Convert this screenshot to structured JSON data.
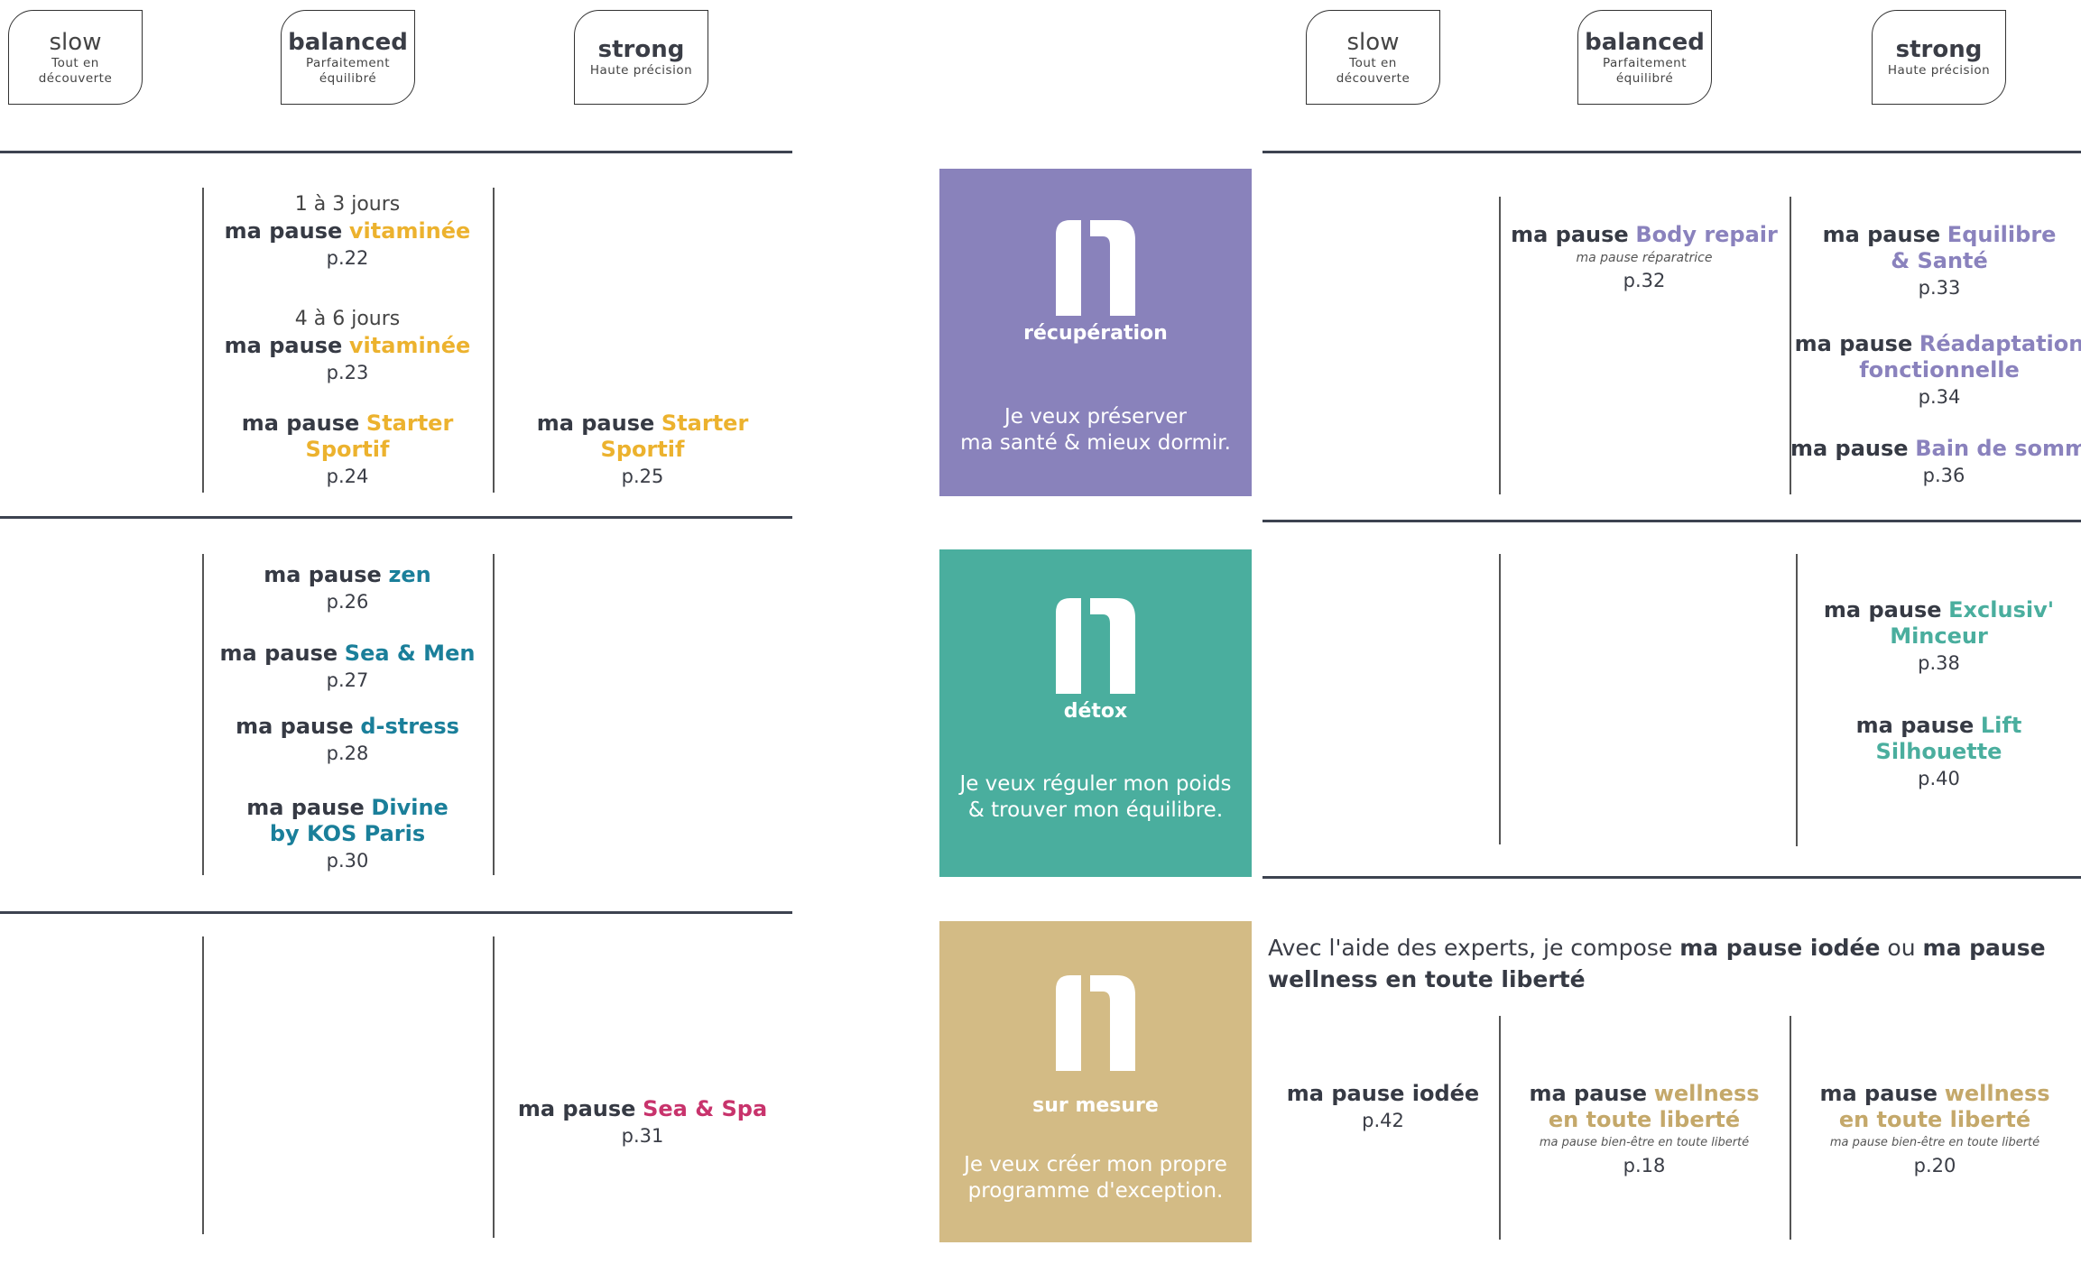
{
  "headers": {
    "slow": {
      "title": "slow",
      "sub_1": "Tout en",
      "sub_2": "découverte"
    },
    "balanced": {
      "title": "balanced",
      "sub_1": "Parfaitement",
      "sub_2": "équilibré"
    },
    "strong": {
      "title": "strong",
      "sub": "Haute précision"
    }
  },
  "common": {
    "prefix": "ma pause"
  },
  "left": {
    "s1": {
      "e1": {
        "duration": "1 à 3 jours",
        "name": "vitaminée",
        "page": "p.22"
      },
      "e2": {
        "duration": "4 à 6 jours",
        "name": "vitaminée",
        "page": "p.23"
      },
      "e3": {
        "name": "Starter Sportif",
        "page": "p.24"
      },
      "e4": {
        "name": "Starter Sportif",
        "page": "p.25"
      }
    },
    "s2": {
      "e1": {
        "name": "zen",
        "page": "p.26"
      },
      "e2": {
        "name": "Sea & Men",
        "page": "p.27"
      },
      "e3": {
        "name": "d-stress",
        "page": "p.28"
      },
      "e4": {
        "name_1": "Divine",
        "name_2": "by KOS Paris",
        "page": "p.30"
      }
    },
    "s3": {
      "e1": {
        "name": "Sea & Spa",
        "page": "p.31"
      }
    }
  },
  "panels": {
    "recup": {
      "label": "récupération",
      "tag_1": "Je veux préserver",
      "tag_2": "ma santé & mieux dormir.",
      "color": "#8982bb"
    },
    "detox": {
      "label": "détox",
      "tag_1": "Je veux réguler mon poids",
      "tag_2": "& trouver mon équilibre.",
      "color": "#4aae9e"
    },
    "mesure": {
      "label": "sur mesure",
      "tag_1": "Je veux créer mon propre",
      "tag_2": "programme d'exception.",
      "color": "#d3bb85"
    }
  },
  "right": {
    "recup": {
      "e1": {
        "name": "Body repair",
        "italic": "ma pause réparatrice",
        "page": "p.32"
      },
      "e2": {
        "name_1": "Equilibre",
        "name_2": "& Santé",
        "page": "p.33"
      },
      "e3": {
        "name_1": "Réadaptation",
        "name_2": "fonctionnelle",
        "page": "p.34"
      },
      "e4": {
        "name": "Bain de sommeil",
        "page": "p.36"
      }
    },
    "detox": {
      "e1": {
        "name_1": "Exclusiv'",
        "name_2": "Minceur",
        "page": "p.38"
      },
      "e2": {
        "name": "Lift Silhouette",
        "page": "p.40"
      }
    },
    "mesure": {
      "intro_1": "Avec l'aide des experts, je compose ",
      "intro_b1": "ma pause iodée",
      "intro_2": " ou ",
      "intro_b2": "ma pause wellness en toute liberté",
      "e1": {
        "name": "ma pause iodée",
        "page": "p.42"
      },
      "e2": {
        "name_1": "wellness",
        "name_2": "en toute liberté",
        "italic": "ma pause bien-être en toute liberté",
        "page": "p.18"
      },
      "e3": {
        "name_1": "wellness",
        "name_2": "en toute liberté",
        "italic": "ma pause bien-être en toute liberté",
        "page": "p.20"
      }
    }
  }
}
